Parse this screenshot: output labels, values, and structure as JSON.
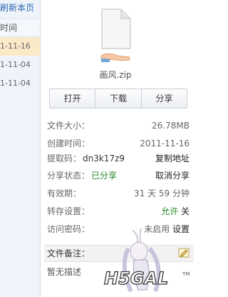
{
  "left_panel": {
    "refresh_label": "刷新本页",
    "column_header": "时间",
    "rows": [
      "1-11-16",
      "1-11-04",
      "1-11-04"
    ]
  },
  "file": {
    "icon": "file-icon",
    "share_icon": "hand-share-icon",
    "name": "画风.zip"
  },
  "actions": {
    "open": "打开",
    "download": "下载",
    "share": "分享"
  },
  "info": {
    "size_label": "文件大小：",
    "size_value": "26.78MB",
    "created_label": "创建时间：",
    "created_value": "2011-11-16",
    "code_label": "提取码：",
    "code_value": "dn3k17z9",
    "copy_link": "复制地址",
    "share_status_label": "分享状态：",
    "share_status_value": "已分享",
    "cancel_share": "取消分享",
    "validity_label": "有效期：",
    "validity_value": "31 天 59 分钟",
    "transfer_label": "转存设置：",
    "transfer_allow": "允许",
    "transfer_off": "关",
    "password_label": "访问密码：",
    "password_status": "未启用",
    "password_setting": "设置"
  },
  "note": {
    "title": "文件备注：",
    "text": "暂无描述",
    "edit_icon": "edit-icon"
  },
  "watermark": {
    "brand": "H5GAL"
  },
  "colors": {
    "link_blue": "#2d64b3",
    "status_green": "#2a8a2a",
    "selected_row": "#fbe9c8"
  }
}
